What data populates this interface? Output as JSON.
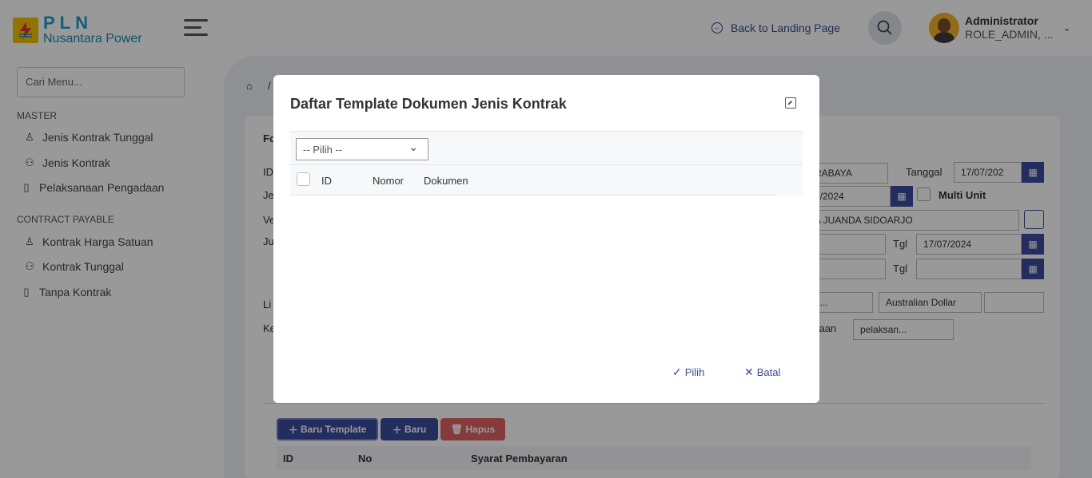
{
  "header": {
    "logo_title": "PLN",
    "logo_subtitle": "Nusantara Power",
    "back_link": "Back to Landing Page",
    "user_name": "Administrator",
    "user_role": "ROLE_ADMIN, ...",
    "icons": {
      "logo": "lightning-logo",
      "menu": "hamburger-icon",
      "back": "back-arrow-icon",
      "search": "search-icon",
      "user": "avatar",
      "chevron": "chevron-down-icon"
    }
  },
  "sidebar": {
    "search_placeholder": "Cari Menu...",
    "groups": [
      {
        "label": "MASTER",
        "items": [
          {
            "label": "Jenis Kontrak Tunggal",
            "icon": "user-icon"
          },
          {
            "label": "Jenis Kontrak",
            "icon": "users-icon"
          },
          {
            "label": "Pelaksanaan Pengadaan",
            "icon": "bookmark-icon"
          }
        ]
      },
      {
        "label": "CONTRACT PAYABLE",
        "items": [
          {
            "label": "Kontrak Harga Satuan",
            "icon": "user-icon"
          },
          {
            "label": "Kontrak Tunggal",
            "icon": "users-icon"
          },
          {
            "label": "Tanpa Kontrak",
            "icon": "bookmark-icon"
          }
        ]
      }
    ]
  },
  "background_form": {
    "breadcrumb_sep": "/",
    "label_fo": "Fo",
    "label_id": "ID",
    "label_je": "Je",
    "label_ve": "Ve",
    "label_ju": "Ju",
    "label_li": "Li",
    "label_ke": "Ke",
    "value_city": "RABAYA",
    "label_tanggal": "Tanggal",
    "value_tanggal": "17/07/202",
    "value_date2": "7/2024",
    "label_multi_unit": "Multi Unit",
    "value_address": "A JUANDA SIDOARJO",
    "label_tgl_1": "Tgl",
    "value_tgl_1": "17/07/2024",
    "label_tgl_2": "Tgl",
    "value_currency_short": "u...",
    "value_currency": "Australian Dollar",
    "label_adaan": "adaan",
    "value_pelaksanaan": "pelaksan...",
    "btn_baru_template": "Baru Template",
    "btn_baru": "Baru",
    "btn_hapus": "Hapus",
    "table_headers": [
      "ID",
      "No",
      "Syarat Pembayaran"
    ]
  },
  "modal": {
    "title": "Daftar Template Dokumen Jenis Kontrak",
    "select_value": "-- Pilih --",
    "columns": [
      "ID",
      "Nomor",
      "Dokumen"
    ],
    "confirm_label": "Pilih",
    "cancel_label": "Batal"
  }
}
